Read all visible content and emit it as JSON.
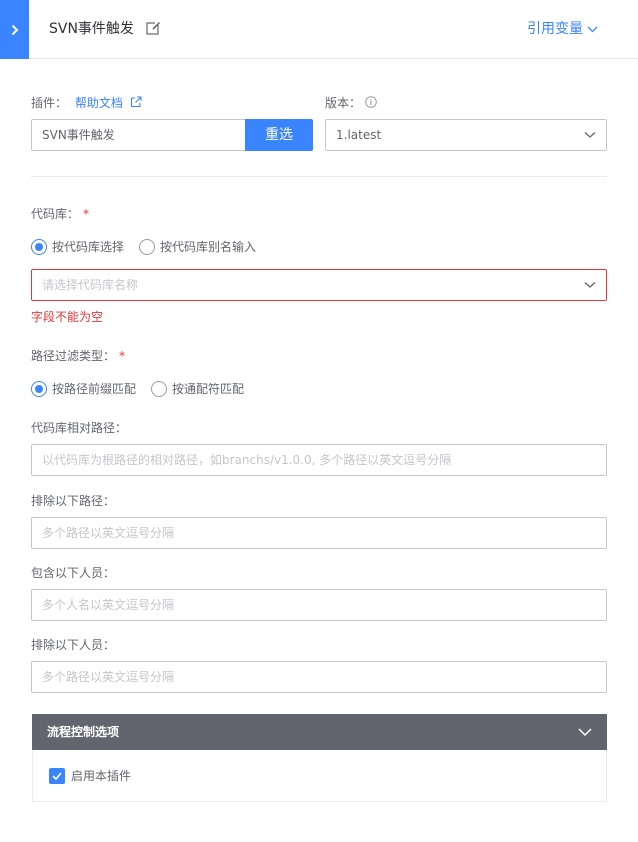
{
  "header": {
    "title": "SVN事件触发",
    "ref_var_label": "引用变量"
  },
  "plugin": {
    "label": "插件：",
    "help_link": "帮助文档",
    "value": "SVN事件触发",
    "reselect_label": "重选"
  },
  "version": {
    "label": "版本：",
    "value": "1.latest"
  },
  "repo": {
    "label": "代码库：",
    "required_mark": "*",
    "radio_options": [
      "按代码库选择",
      "按代码库别名输入"
    ],
    "selected_option": 0,
    "placeholder": "请选择代码库名称",
    "error": "字段不能为空"
  },
  "path_filter": {
    "label": "路径过滤类型：",
    "required_mark": "*",
    "radio_options": [
      "按路径前缀匹配",
      "按通配符匹配"
    ],
    "selected_option": 0
  },
  "relative_path": {
    "label": "代码库相对路径：",
    "placeholder": "以代码库为根路径的相对路径，如branchs/v1.0.0, 多个路径以英文逗号分隔"
  },
  "exclude_paths": {
    "label": "排除以下路径：",
    "placeholder": "多个路径以英文逗号分隔"
  },
  "include_users": {
    "label": "包含以下人员：",
    "placeholder": "多个人名以英文逗号分隔"
  },
  "exclude_users": {
    "label": "排除以下人员：",
    "placeholder": "多个路径以英文逗号分隔"
  },
  "flow_control": {
    "title": "流程控制选项",
    "enable_label": "启用本插件",
    "enabled": true
  },
  "colors": {
    "accent": "#3a84ff",
    "error": "#ea3636",
    "panel_header": "#63656e"
  }
}
